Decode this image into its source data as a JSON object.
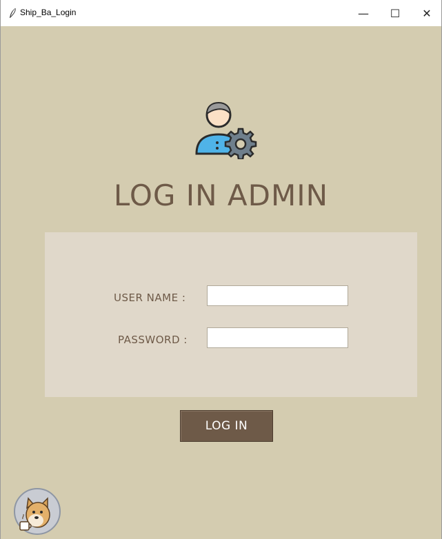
{
  "window": {
    "title": "Ship_Ba_Login",
    "controls": {
      "minimize": "—",
      "maximize": "☐",
      "close": "✕"
    }
  },
  "header": {
    "icon": "admin-user-gear-icon",
    "title": "LOG IN ADMIN"
  },
  "form": {
    "username_label": "USER NAME  :",
    "username_value": "",
    "password_label": "PASSWORD  :",
    "password_value": ""
  },
  "actions": {
    "login_label": "LOG IN"
  },
  "footer": {
    "mascot_icon": "doge-coffee-avatar"
  },
  "colors": {
    "background": "#d4ccb0",
    "panel": "#e0d8ca",
    "accent": "#6e5a48",
    "button_text": "#ffffff"
  }
}
